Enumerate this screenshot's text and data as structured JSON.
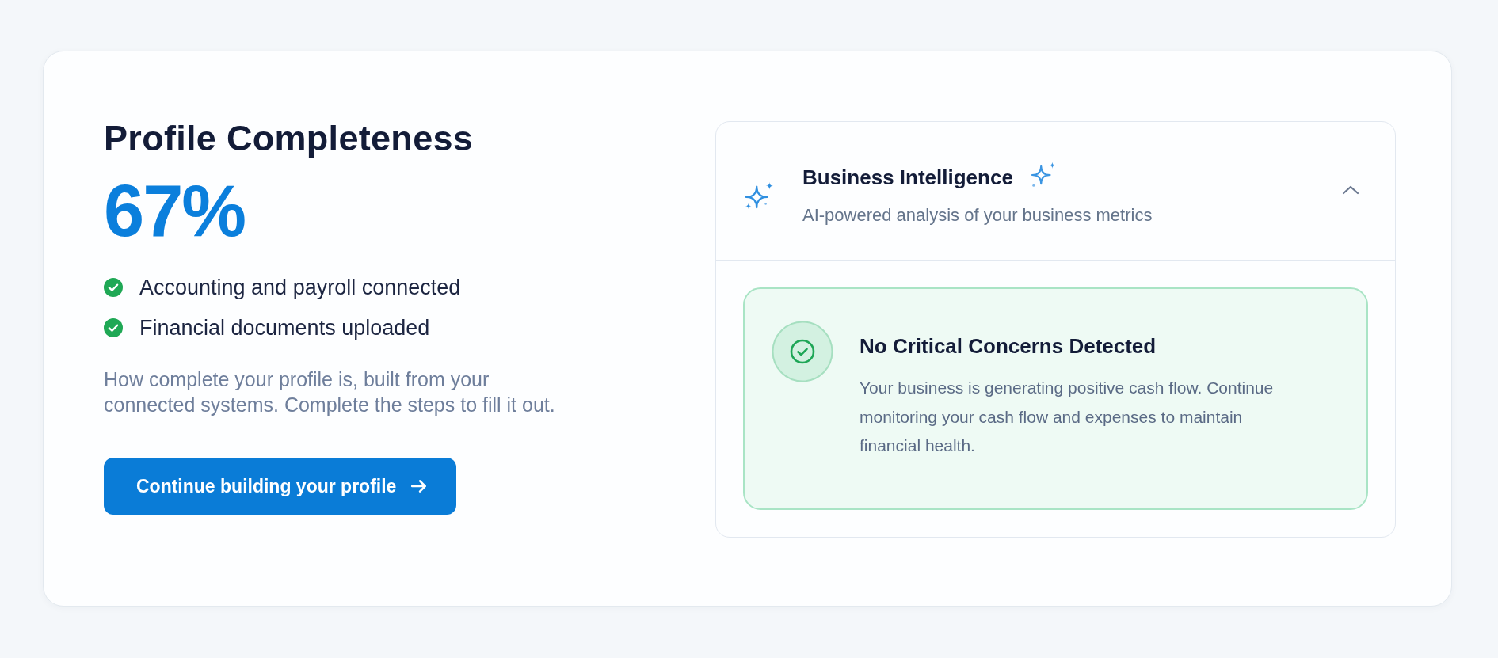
{
  "profile": {
    "title": "Profile Completeness",
    "percent": "67%",
    "checklist": [
      {
        "label": "Accounting and payroll connected",
        "checked": true
      },
      {
        "label": "Financial documents uploaded",
        "checked": true
      }
    ],
    "description": "How complete your profile is, built from your connected systems. Complete the steps to fill it out.",
    "button": {
      "label": "Continue building your profile"
    }
  },
  "insights": {
    "title": "Business Intelligence",
    "subtitle": "AI-powered analysis of your business metrics",
    "expanded": true,
    "alert": {
      "kind": "success",
      "title": "No Critical Concerns Detected",
      "message": "Your business is generating positive cash flow. Continue monitoring your cash flow and expenses to maintain financial health."
    }
  }
}
